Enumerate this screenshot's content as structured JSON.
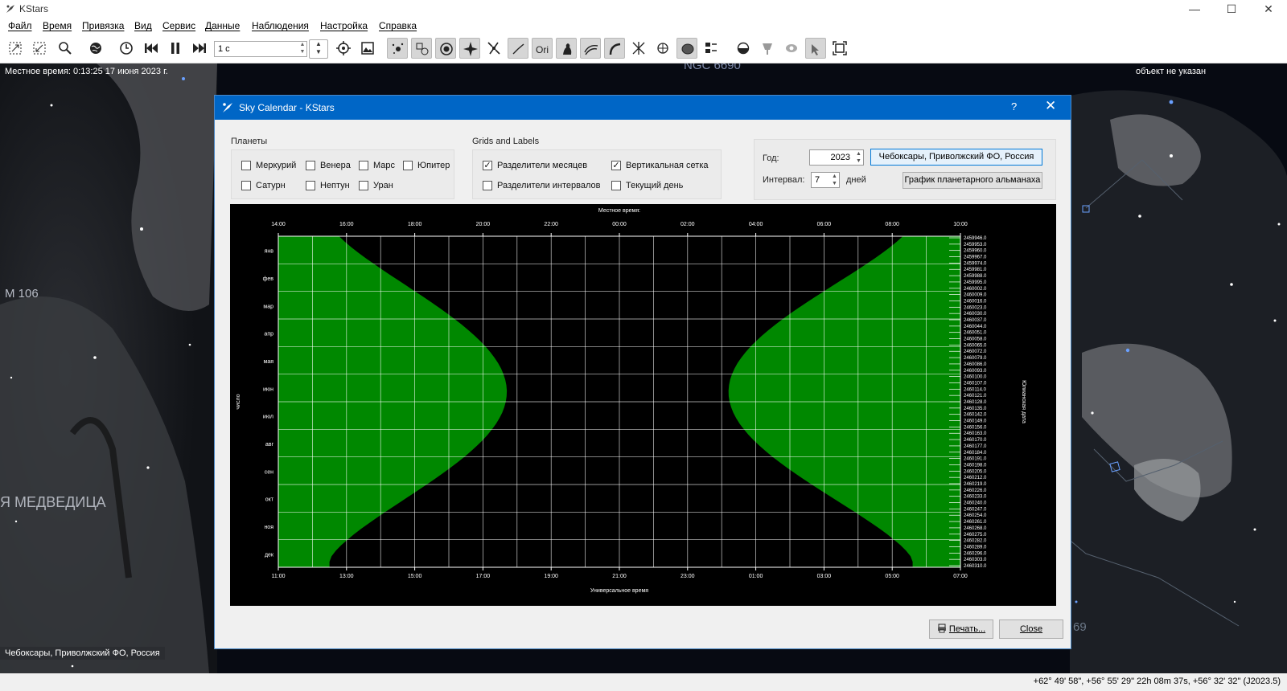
{
  "app": {
    "title": "KStars"
  },
  "window_controls": {
    "minimize": "—",
    "maximize": "☐",
    "close": "✕"
  },
  "menu": [
    "Файл",
    "Время",
    "Привязка",
    "Вид",
    "Сервис",
    "Данные",
    "Наблюдения",
    "Настройка",
    "Справка"
  ],
  "toolbar": {
    "time_step": "1 с"
  },
  "sky": {
    "local_time": "Местное время: 0:13:25   17 июня 2023 г.",
    "focus_object": "объект не указан",
    "label_ngc": "NGC 6690",
    "label_m106": "M 106",
    "label_ursa": "Я МЕДВЕДИЦА",
    "label_69": "69",
    "location": "Чебоксары, Приволжский ФО, Россия"
  },
  "status": {
    "coords": "+62° 49' 58\", +56° 55' 29\"  22h 08m 37s, +56° 32' 32\" (J2023.5)"
  },
  "dialog": {
    "title": "Sky Calendar - KStars",
    "help": "?",
    "close_icon": "✕",
    "planets_group": "Планеты",
    "planets": [
      "Меркурий",
      "Венера",
      "Марс",
      "Юпитер",
      "Сатурн",
      "Нептун",
      "Уран"
    ],
    "grids_group": "Grids and Labels",
    "grid_options": [
      {
        "label": "Разделители месяцев",
        "checked": true
      },
      {
        "label": "Вертикальная сетка",
        "checked": true
      },
      {
        "label": "Разделители интервалов",
        "checked": false
      },
      {
        "label": "Текущий день",
        "checked": false
      }
    ],
    "year_label": "Год:",
    "year_value": "2023",
    "interval_label": "Интервал:",
    "interval_value": "7",
    "interval_unit": "дней",
    "location_button": "Чебоксары, Приволжский ФО, Россия",
    "almanac_button": "График планетарного альманаха",
    "print_button": "Печать...",
    "close_button": "Close"
  },
  "chart_data": {
    "type": "area",
    "top_axis_title": "Местное время:",
    "bottom_axis_title": "Универсальное время",
    "left_axis_title": "число",
    "right_axis_title": "Юлианская дата",
    "top_ticks": [
      "14:00",
      "16:00",
      "18:00",
      "20:00",
      "22:00",
      "00:00",
      "02:00",
      "04:00",
      "06:00",
      "08:00",
      "10:00"
    ],
    "bottom_ticks": [
      "11:00",
      "13:00",
      "15:00",
      "17:00",
      "19:00",
      "21:00",
      "23:00",
      "01:00",
      "03:00",
      "05:00",
      "07:00"
    ],
    "months": [
      "янв",
      "фев",
      "мар",
      "апр",
      "мая",
      "июн",
      "июл",
      "авг",
      "сен",
      "окт",
      "ноя",
      "дек"
    ],
    "jd_labels": [
      "2459946.0",
      "2459953.0",
      "2459960.0",
      "2459967.0",
      "2459974.0",
      "2459981.0",
      "2459988.0",
      "2459995.0",
      "2460002.0",
      "2460009.0",
      "2460016.0",
      "2460023.0",
      "2460030.0",
      "2460037.0",
      "2460044.0",
      "2460051.0",
      "2460058.0",
      "2460065.0",
      "2460072.0",
      "2460079.0",
      "2460086.0",
      "2460093.0",
      "2460100.0",
      "2460107.0",
      "2460114.0",
      "2460121.0",
      "2460128.0",
      "2460135.0",
      "2460142.0",
      "2460149.0",
      "2460156.0",
      "2460163.0",
      "2460170.0",
      "2460177.0",
      "2460184.0",
      "2460191.0",
      "2460198.0",
      "2460205.0",
      "2460212.0",
      "2460219.0",
      "2460226.0",
      "2460233.0",
      "2460240.0",
      "2460247.0",
      "2460254.0",
      "2460261.0",
      "2460268.0",
      "2460275.0",
      "2460282.0",
      "2460289.0",
      "2460296.0",
      "2460303.0",
      "2460310.0"
    ],
    "x_range_local_hours": [
      14,
      34
    ],
    "series": [
      {
        "sunset_local_hours": [
          15.5,
          17.8,
          20.7,
          15.5
        ],
        "color": "#008800"
      }
    ],
    "daylight_colors": {
      "day": "#008800",
      "night": "#000000",
      "grid": "#ffffff"
    }
  }
}
